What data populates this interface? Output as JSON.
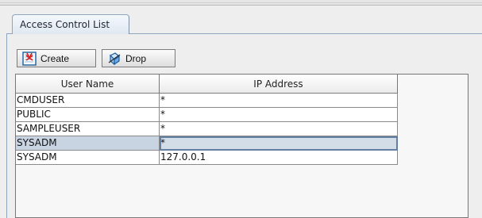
{
  "tab": {
    "label": "Access Control List"
  },
  "toolbar": {
    "create_label": "Create",
    "drop_label": "Drop",
    "create_icon": "new-item-icon",
    "drop_icon": "delete-item-icon"
  },
  "table": {
    "columns": [
      "User Name",
      "IP Address"
    ],
    "rows": [
      {
        "user": "CMDUSER",
        "ip": "*"
      },
      {
        "user": "PUBLIC",
        "ip": "*"
      },
      {
        "user": "SAMPLEUSER",
        "ip": "*"
      },
      {
        "user": "SYSADM",
        "ip": "*"
      },
      {
        "user": "SYSADM",
        "ip": "127.0.0.1"
      }
    ],
    "selected_row": 4
  }
}
